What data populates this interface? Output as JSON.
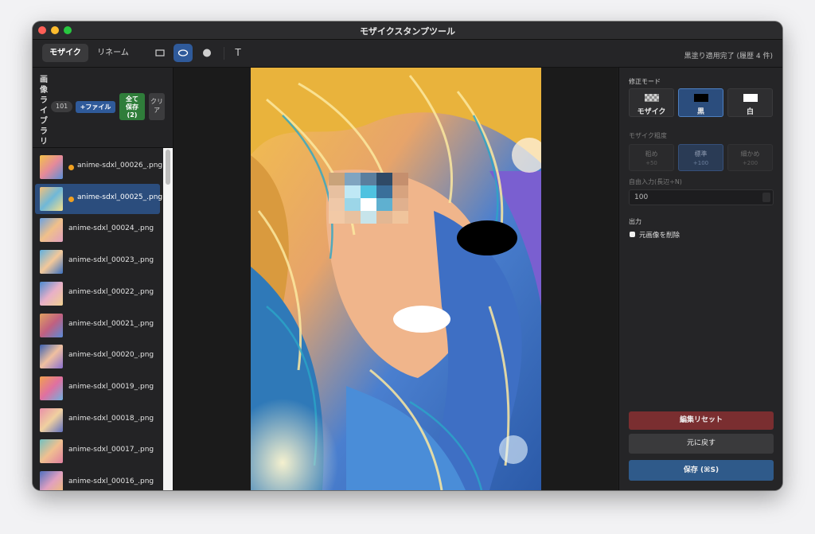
{
  "window": {
    "title": "モザイクスタンプツール"
  },
  "toolbar": {
    "tabs": [
      {
        "label": "モザイク",
        "active": true
      },
      {
        "label": "リネーム",
        "active": false
      }
    ],
    "tools": [
      {
        "icon": "rectangle-icon",
        "active": false
      },
      {
        "icon": "ellipse-icon",
        "active": true
      },
      {
        "icon": "circle-brush-icon",
        "active": false
      },
      {
        "icon": "text-tool-icon",
        "label": "T",
        "active": false
      }
    ],
    "status": "黒塗り適用完了 (履歴 4 件)"
  },
  "library": {
    "title": "画像ライブラリ",
    "count": "101",
    "add_file_label": "+ファイル",
    "save_all_label": "全て保存(2)",
    "save_all_lines": [
      "全て",
      "保存",
      "(2)"
    ],
    "clear_lines": [
      "クリ",
      "ア"
    ],
    "files": [
      {
        "name": "anime-sdxl_00026_.png",
        "modified": true,
        "selected": false
      },
      {
        "name": "anime-sdxl_00025_.png",
        "modified": true,
        "selected": true
      },
      {
        "name": "anime-sdxl_00024_.png",
        "modified": false,
        "selected": false
      },
      {
        "name": "anime-sdxl_00023_.png",
        "modified": false,
        "selected": false
      },
      {
        "name": "anime-sdxl_00022_.png",
        "modified": false,
        "selected": false
      },
      {
        "name": "anime-sdxl_00021_.png",
        "modified": false,
        "selected": false
      },
      {
        "name": "anime-sdxl_00020_.png",
        "modified": false,
        "selected": false
      },
      {
        "name": "anime-sdxl_00019_.png",
        "modified": false,
        "selected": false
      },
      {
        "name": "anime-sdxl_00018_.png",
        "modified": false,
        "selected": false
      },
      {
        "name": "anime-sdxl_00017_.png",
        "modified": false,
        "selected": false
      },
      {
        "name": "anime-sdxl_00016_.png",
        "modified": false,
        "selected": false
      }
    ]
  },
  "panel": {
    "mode_label": "修正モード",
    "modes": [
      {
        "label": "モザイク",
        "icon": "mosaic-pattern-icon",
        "selected": false
      },
      {
        "label": "黒",
        "icon": "black-swatch-icon",
        "selected": true
      },
      {
        "label": "白",
        "icon": "white-swatch-icon",
        "selected": false
      }
    ],
    "grain_label": "モザイク粗度",
    "grains": [
      {
        "name": "粗め",
        "value": "+50",
        "selected": false
      },
      {
        "name": "標準",
        "value": "+100",
        "selected": true
      },
      {
        "name": "細かめ",
        "value": "+200",
        "selected": false
      }
    ],
    "free_input_label": "自由入力(長辺÷N)",
    "free_input_value": "100",
    "output_label": "出力",
    "delete_original_label": "元画像を削除",
    "delete_original_checked": false,
    "reset_label": "編集リセット",
    "undo_label": "元に戻す",
    "save_label": "保存 (⌘S)"
  },
  "colors": {
    "accent": "#2f5a9a",
    "save_all": "#2f7d3a",
    "reset": "#7a2e30",
    "modified_dot": "#f0a020"
  }
}
